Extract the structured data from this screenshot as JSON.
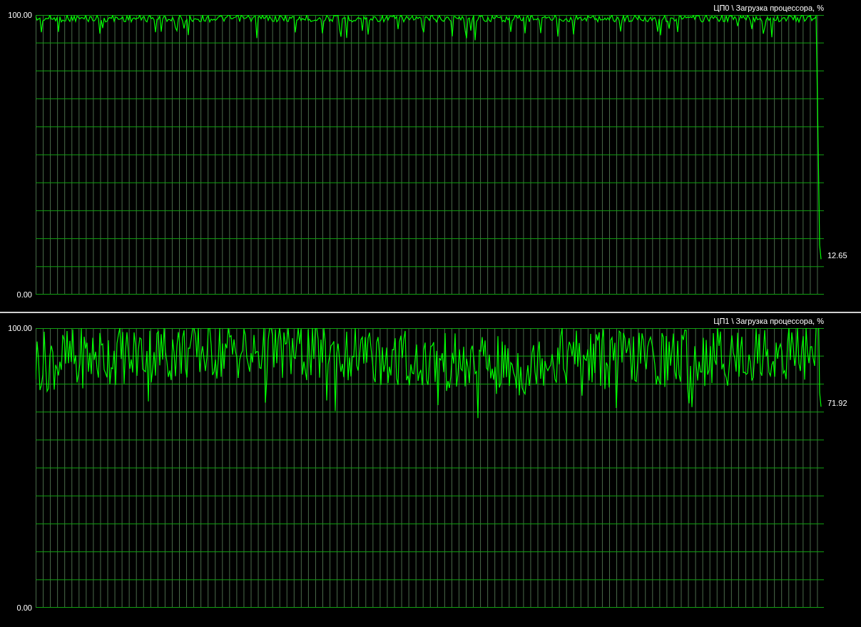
{
  "graphs": [
    {
      "title": "ЦП0 \\ Загрузка процессора, %",
      "y_max_label": "100.00",
      "y_min_label": "0.00",
      "reading": "12.65"
    },
    {
      "title": "ЦП1 \\ Загрузка процессора, %",
      "y_max_label": "100.00",
      "y_min_label": "0.00",
      "reading": "71.92"
    }
  ]
}
